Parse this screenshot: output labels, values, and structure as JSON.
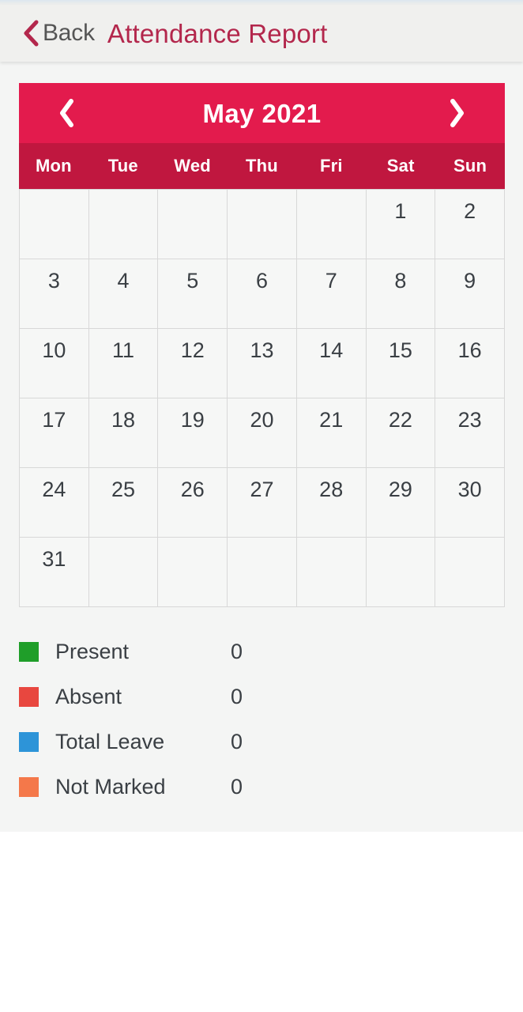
{
  "navbar": {
    "back_label": "Back",
    "back_icon": "chevron-left-icon",
    "title": "Attendance Report",
    "title_color": "#b3274c",
    "back_color": "#555555"
  },
  "calendar": {
    "month_label": "May 2021",
    "prev_icon": "chevron-left-icon",
    "next_icon": "chevron-right-icon",
    "header_color": "#e31b4d",
    "weekday_header_color": "#c0173f",
    "weekdays": [
      "Mon",
      "Tue",
      "Wed",
      "Thu",
      "Fri",
      "Sat",
      "Sun"
    ],
    "weeks": [
      [
        "",
        "",
        "",
        "",
        "",
        "1",
        "2"
      ],
      [
        "3",
        "4",
        "5",
        "6",
        "7",
        "8",
        "9"
      ],
      [
        "10",
        "11",
        "12",
        "13",
        "14",
        "15",
        "16"
      ],
      [
        "17",
        "18",
        "19",
        "20",
        "21",
        "22",
        "23"
      ],
      [
        "24",
        "25",
        "26",
        "27",
        "28",
        "29",
        "30"
      ],
      [
        "31",
        "",
        "",
        "",
        "",
        "",
        ""
      ]
    ]
  },
  "legend": {
    "items": [
      {
        "label": "Present",
        "value": "0",
        "color": "#1f9e29"
      },
      {
        "label": "Absent",
        "value": "0",
        "color": "#e8473f"
      },
      {
        "label": "Total Leave",
        "value": "0",
        "color": "#2d94d8"
      },
      {
        "label": "Not Marked",
        "value": "0",
        "color": "#f4784a"
      }
    ]
  }
}
